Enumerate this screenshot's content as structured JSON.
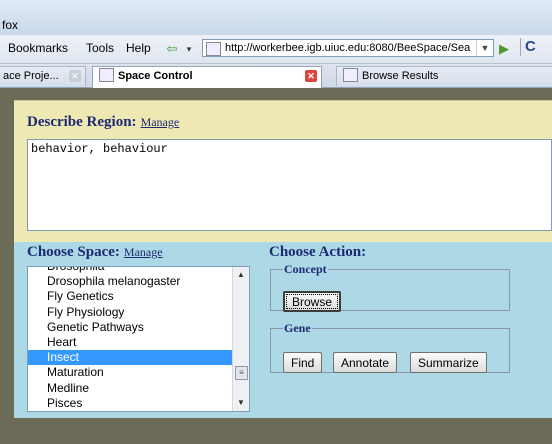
{
  "browser": {
    "title_fragment": "fox",
    "menu": [
      "Bookmarks",
      "Tools",
      "Help"
    ],
    "url": "http://workerbee.igb.uiuc.edu:8080/BeeSpace/Sea",
    "tabs": [
      "ace Proje...",
      "Space Control",
      "Browse Results"
    ],
    "go_icon": "play-icon",
    "back_icon": "back-arrow-icon"
  },
  "describe": {
    "heading": "Describe Region:",
    "manage_label": "Manage",
    "query_text": "behavior, behaviour",
    "bg_color": "#eee8b2"
  },
  "space": {
    "heading": "Choose Space:",
    "manage_label": "Manage",
    "options": [
      "Drosophila",
      "Drosophila melanogaster",
      "Fly Genetics",
      "Fly Physiology",
      "Genetic Pathways",
      "Heart",
      "Insect",
      "Maturation",
      "Medline",
      "Pisces"
    ],
    "selected": "Insect",
    "bg_color": "#add8e6"
  },
  "action": {
    "heading": "Choose Action:",
    "concept_legend": "Concept",
    "browse_label": "Browse",
    "gene_legend": "Gene",
    "find_label": "Find",
    "annotate_label": "Annotate",
    "summarize_label": "Summarize"
  },
  "colors": {
    "heading": "#1c2a74",
    "selection": "#3399ff",
    "page_bg": "#6b6b58"
  }
}
